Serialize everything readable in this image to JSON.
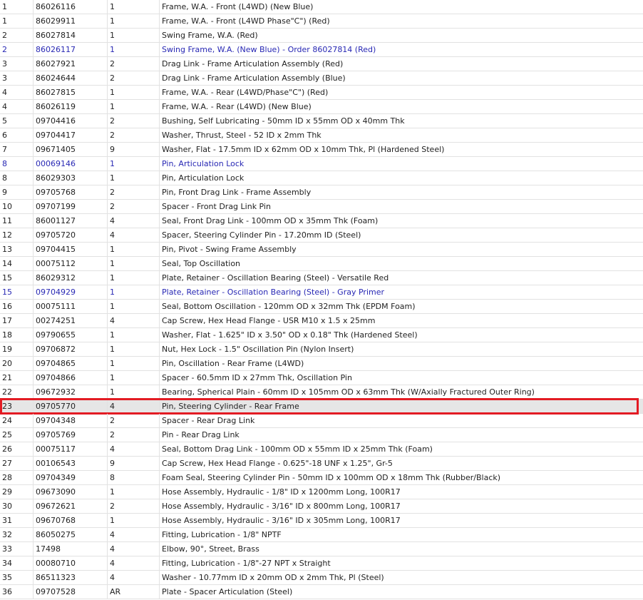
{
  "parts": {
    "rows": [
      {
        "item": "1",
        "part": "86026116",
        "qty": "1",
        "desc": "Frame, W.A. - Front (L4WD) (New Blue)",
        "alt": false
      },
      {
        "item": "1",
        "part": "86029911",
        "qty": "1",
        "desc": "Frame, W.A. - Front (L4WD Phase\"C\") (Red)",
        "alt": false
      },
      {
        "item": "2",
        "part": "86027814",
        "qty": "1",
        "desc": "Swing Frame, W.A. (Red)",
        "alt": false
      },
      {
        "item": "2",
        "part": "86026117",
        "qty": "1",
        "desc": "Swing Frame, W.A. (New Blue) - Order 86027814 (Red)",
        "alt": true
      },
      {
        "item": "3",
        "part": "86027921",
        "qty": "2",
        "desc": "Drag Link - Frame Articulation Assembly (Red)",
        "alt": false
      },
      {
        "item": "3",
        "part": "86024644",
        "qty": "2",
        "desc": "Drag Link - Frame Articulation Assembly (Blue)",
        "alt": false
      },
      {
        "item": "4",
        "part": "86027815",
        "qty": "1",
        "desc": "Frame, W.A. - Rear (L4WD/Phase\"C\") (Red)",
        "alt": false
      },
      {
        "item": "4",
        "part": "86026119",
        "qty": "1",
        "desc": "Frame, W.A. - Rear (L4WD) (New Blue)",
        "alt": false
      },
      {
        "item": "5",
        "part": "09704416",
        "qty": "2",
        "desc": "Bushing, Self Lubricating - 50mm ID x 55mm OD x 40mm Thk",
        "alt": false
      },
      {
        "item": "6",
        "part": "09704417",
        "qty": "2",
        "desc": "Washer, Thrust, Steel - 52 ID x 2mm Thk",
        "alt": false
      },
      {
        "item": "7",
        "part": "09671405",
        "qty": "9",
        "desc": "Washer, Flat - 17.5mm ID x 62mm OD x 10mm Thk, Pl (Hardened Steel)",
        "alt": false
      },
      {
        "item": "8",
        "part": "00069146",
        "qty": "1",
        "desc": "Pin, Articulation Lock",
        "alt": true
      },
      {
        "item": "8",
        "part": "86029303",
        "qty": "1",
        "desc": "Pin, Articulation Lock",
        "alt": false
      },
      {
        "item": "9",
        "part": "09705768",
        "qty": "2",
        "desc": "Pin, Front Drag Link - Frame Assembly",
        "alt": false
      },
      {
        "item": "10",
        "part": "09707199",
        "qty": "2",
        "desc": "Spacer - Front Drag Link Pin",
        "alt": false
      },
      {
        "item": "11",
        "part": "86001127",
        "qty": "4",
        "desc": "Seal, Front Drag Link - 100mm OD x 35mm Thk (Foam)",
        "alt": false
      },
      {
        "item": "12",
        "part": "09705720",
        "qty": "4",
        "desc": "Spacer, Steering Cylinder Pin - 17.20mm ID (Steel)",
        "alt": false
      },
      {
        "item": "13",
        "part": "09704415",
        "qty": "1",
        "desc": "Pin, Pivot - Swing Frame Assembly",
        "alt": false
      },
      {
        "item": "14",
        "part": "00075112",
        "qty": "1",
        "desc": "Seal, Top Oscillation",
        "alt": false
      },
      {
        "item": "15",
        "part": "86029312",
        "qty": "1",
        "desc": "Plate, Retainer - Oscillation Bearing (Steel) - Versatile Red",
        "alt": false
      },
      {
        "item": "15",
        "part": "09704929",
        "qty": "1",
        "desc": "Plate, Retainer - Oscillation Bearing (Steel) - Gray Primer",
        "alt": true
      },
      {
        "item": "16",
        "part": "00075111",
        "qty": "1",
        "desc": "Seal, Bottom Oscillation - 120mm OD x 32mm Thk (EPDM Foam)",
        "alt": false
      },
      {
        "item": "17",
        "part": "00274251",
        "qty": "4",
        "desc": "Cap Screw, Hex Head Flange - USR M10 x 1.5 x 25mm",
        "alt": false
      },
      {
        "item": "18",
        "part": "09790655",
        "qty": "1",
        "desc": "Washer, Flat - 1.625\" ID x 3.50\" OD x 0.18\" Thk (Hardened Steel)",
        "alt": false
      },
      {
        "item": "19",
        "part": "09706872",
        "qty": "1",
        "desc": "Nut, Hex Lock - 1.5\" Oscillation Pin (Nylon Insert)",
        "alt": false
      },
      {
        "item": "20",
        "part": "09704865",
        "qty": "1",
        "desc": "Pin, Oscillation - Rear Frame (L4WD)",
        "alt": false
      },
      {
        "item": "21",
        "part": "09704866",
        "qty": "1",
        "desc": "Spacer - 60.5mm ID x 27mm Thk, Oscillation Pin",
        "alt": false
      },
      {
        "item": "22",
        "part": "09672932",
        "qty": "1",
        "desc": "Bearing, Spherical Plain - 60mm ID x 105mm OD x 63mm Thk (W/Axially Fractured Outer Ring)",
        "alt": false
      },
      {
        "item": "23",
        "part": "09705770",
        "qty": "4",
        "desc": "Pin, Steering Cylinder - Rear Frame",
        "alt": false,
        "highlighted": true
      },
      {
        "item": "24",
        "part": "09704348",
        "qty": "2",
        "desc": "Spacer - Rear Drag Link",
        "alt": false
      },
      {
        "item": "25",
        "part": "09705769",
        "qty": "2",
        "desc": "Pin - Rear Drag Link",
        "alt": false
      },
      {
        "item": "26",
        "part": "00075117",
        "qty": "4",
        "desc": "Seal, Bottom Drag Link - 100mm OD x 55mm ID x 25mm Thk (Foam)",
        "alt": false
      },
      {
        "item": "27",
        "part": "00106543",
        "qty": "9",
        "desc": "Cap Screw, Hex Head Flange - 0.625\"-18 UNF x 1.25\", Gr-5",
        "alt": false
      },
      {
        "item": "28",
        "part": "09704349",
        "qty": "8",
        "desc": "Foam Seal, Steering Cylinder Pin - 50mm ID x 100mm OD x 18mm Thk (Rubber/Black)",
        "alt": false
      },
      {
        "item": "29",
        "part": "09673090",
        "qty": "1",
        "desc": "Hose Assembly, Hydraulic - 1/8\" ID x 1200mm Long, 100R17",
        "alt": false
      },
      {
        "item": "30",
        "part": "09672621",
        "qty": "2",
        "desc": "Hose Assembly, Hydraulic - 3/16\" ID x 800mm Long, 100R17",
        "alt": false
      },
      {
        "item": "31",
        "part": "09670768",
        "qty": "1",
        "desc": "Hose Assembly, Hydraulic - 3/16\" ID x 305mm Long, 100R17",
        "alt": false
      },
      {
        "item": "32",
        "part": "86050275",
        "qty": "4",
        "desc": "Fitting, Lubrication - 1/8\" NPTF",
        "alt": false
      },
      {
        "item": "33",
        "part": "17498",
        "qty": "4",
        "desc": "Elbow, 90°, Street, Brass",
        "alt": false
      },
      {
        "item": "34",
        "part": "00080710",
        "qty": "4",
        "desc": "Fitting, Lubrication - 1/8\"-27 NPT x Straight",
        "alt": false
      },
      {
        "item": "35",
        "part": "86511323",
        "qty": "4",
        "desc": "Washer - 10.77mm ID x 20mm OD x 2mm Thk, Pl (Steel)",
        "alt": false
      },
      {
        "item": "36",
        "part": "09707528",
        "qty": "AR",
        "desc": "Plate - Spacer Articulation (Steel)",
        "alt": false
      }
    ]
  },
  "colors": {
    "alt_row_text": "#2828b4",
    "highlight_border": "#e31b23",
    "highlight_fill": "#e6e6e6"
  }
}
